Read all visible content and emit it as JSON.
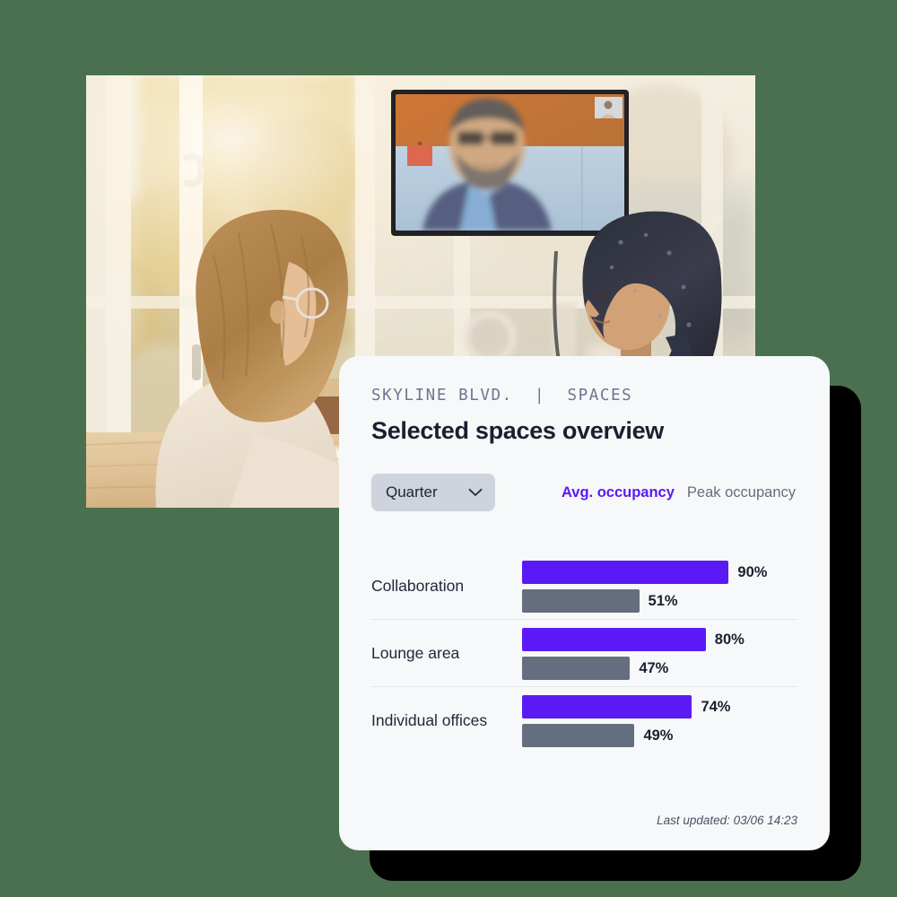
{
  "theme": {
    "page_background": "#4a7050",
    "card_background": "#f7f8f9",
    "accent_purple": "#5b1af5",
    "peak_gray": "#646e7e",
    "title_color": "#1b2030",
    "eyebrow_color": "#6d7590",
    "select_background": "#ced3de",
    "divider_color": "#e3e6ec",
    "shadow_color": "#000000"
  },
  "photo": {
    "name": "office-video-meeting-photo",
    "alt": "Two colleagues at a wooden desk in a sunlit office facing a wall-mounted screen showing a remote participant on a video call"
  },
  "card": {
    "eyebrow": "SKYLINE BLVD.  |  SPACES",
    "title": "Selected spaces overview",
    "period_select": {
      "value": "Quarter",
      "icon": "chevron-down-icon"
    },
    "legend": [
      {
        "label": "Avg. occupancy",
        "state": "active"
      },
      {
        "label": "Peak occupancy",
        "state": "inactive"
      }
    ],
    "footer": "Last updated: 03/06 14:23"
  },
  "chart_data": {
    "type": "bar",
    "title": "Selected spaces overview",
    "xlabel": "",
    "ylabel": "",
    "xlim": [
      0,
      100
    ],
    "unit": "%",
    "orientation": "horizontal",
    "grid": false,
    "legend_position": "top-right",
    "categories": [
      "Collaboration",
      "Lounge area",
      "Individual offices"
    ],
    "series": [
      {
        "name": "Avg. occupancy",
        "color": "#5b1af5",
        "values": [
          90,
          80,
          74
        ]
      },
      {
        "name": "Peak occupancy",
        "color": "#646e7e",
        "values": [
          51,
          47,
          49
        ]
      }
    ],
    "rows": [
      {
        "category": "Collaboration",
        "bars": [
          {
            "series": "Avg. occupancy",
            "value": 90,
            "label": "90%",
            "color": "#5b1af5"
          },
          {
            "series": "Peak occupancy",
            "value": 51,
            "label": "51%",
            "color": "#646e7e"
          }
        ]
      },
      {
        "category": "Lounge area",
        "bars": [
          {
            "series": "Avg. occupancy",
            "value": 80,
            "label": "80%",
            "color": "#5b1af5"
          },
          {
            "series": "Peak occupancy",
            "value": 47,
            "label": "47%",
            "color": "#646e7e"
          }
        ]
      },
      {
        "category": "Individual offices",
        "bars": [
          {
            "series": "Avg. occupancy",
            "value": 74,
            "label": "74%",
            "color": "#5b1af5"
          },
          {
            "series": "Peak occupancy",
            "value": 49,
            "label": "49%",
            "color": "#646e7e"
          }
        ]
      }
    ]
  }
}
